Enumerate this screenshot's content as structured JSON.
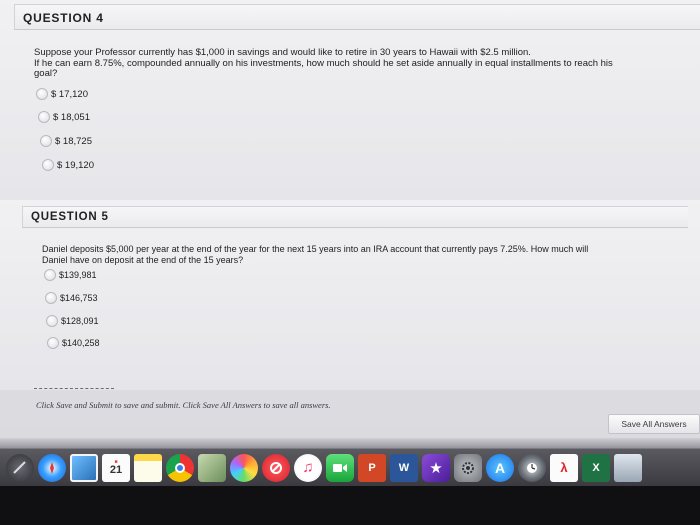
{
  "question4": {
    "title": "QUESTION 4",
    "text_line1": "Suppose your Professor currently has $1,000 in savings and would like to retire in 30 years to Hawaii with $2.5 million.",
    "text_line2": "If he can earn 8.75%, compounded annually on his investments, how much should he set aside annually in equal installments to reach his",
    "text_line3": "goal?",
    "options": [
      "$ 17,120",
      "$ 18,051",
      "$ 18,725",
      "$ 19,120"
    ]
  },
  "question5": {
    "title": "QUESTION 5",
    "text_line1": "Daniel deposits $5,000 per year at the end of the year for the next 15 years into an IRA account that currently pays 7.25%. How much will",
    "text_line2": "Daniel have on deposit at the end of the 15 years?",
    "options": [
      "$139,981",
      "$146,753",
      "$128,091",
      "$140,258"
    ]
  },
  "footer": {
    "instructions": "Click Save and Submit to save and submit. Click Save All Answers to save all answers.",
    "save_all_label": "Save All Answers"
  },
  "dock": {
    "calendar_day": "21",
    "icons": [
      "launchpad-icon",
      "safari-icon",
      "preview-icon",
      "calendar-icon",
      "notes-icon",
      "chrome-icon",
      "photos-icon",
      "photos-color-icon",
      "news-icon",
      "music-icon",
      "facetime-icon",
      "powerpoint-icon",
      "word-icon",
      "imovie-icon",
      "system-prefs-icon",
      "app-store-icon",
      "time-machine-icon",
      "acrobat-icon",
      "excel-icon",
      "finder-window-icon"
    ]
  }
}
